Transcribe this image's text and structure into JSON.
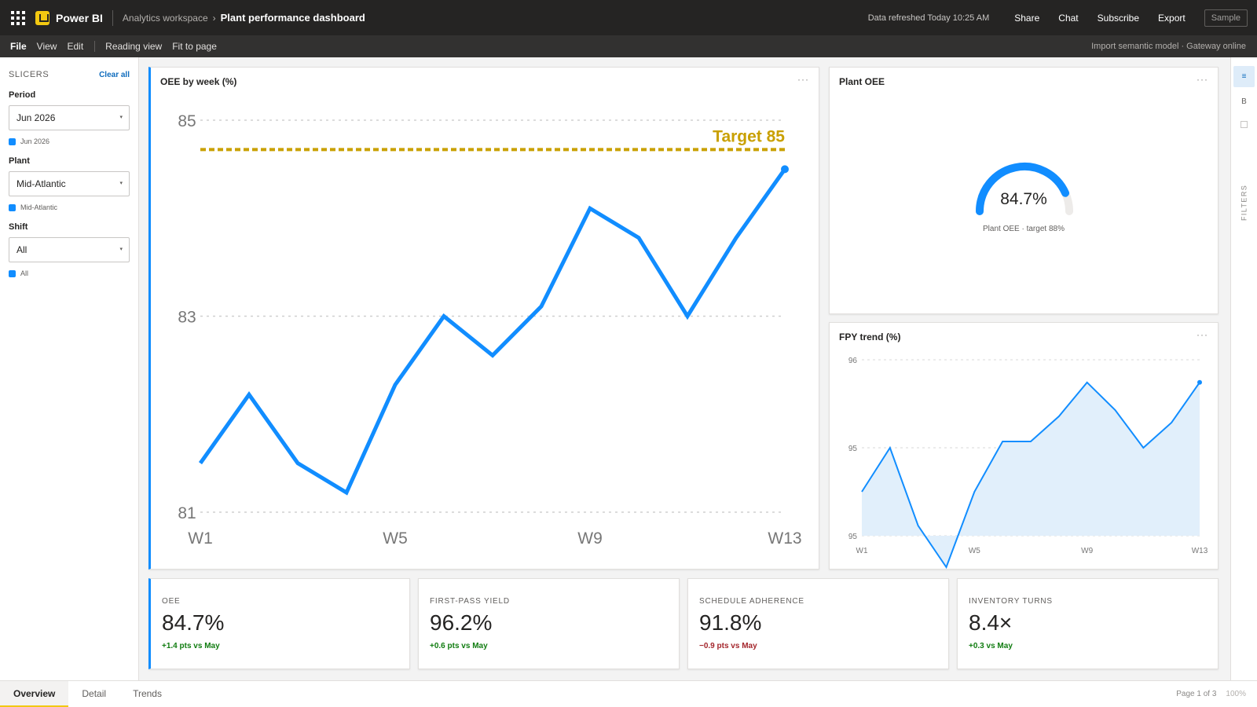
{
  "app": {
    "name": "Power BI",
    "workspace": "Analytics workspace",
    "crumb_sep": "›",
    "report_title": "Plant performance dashboard",
    "refresh_status": "Data refreshed Today 10:25 AM",
    "actions": [
      "Share",
      "Chat",
      "Subscribe",
      "Export"
    ],
    "mode_badge": "Sample"
  },
  "menu": {
    "items": [
      "File",
      "View",
      "Edit"
    ],
    "view_items": [
      "Reading view",
      "Fit to page"
    ],
    "model_status": "Import semantic model · Gateway online"
  },
  "slicers": {
    "title": "SLICERS",
    "clear_all": "Clear all",
    "groups": [
      {
        "label": "Period",
        "value": "Jun 2026",
        "chip": "Jun 2026"
      },
      {
        "label": "Plant",
        "value": "Mid-Atlantic",
        "chip": "Mid-Atlantic"
      },
      {
        "label": "Shift",
        "value": "All",
        "chip": "All"
      }
    ],
    "chevron": "▾"
  },
  "more_glyph": "···",
  "oee_chart": {
    "title": "OEE by week (%)",
    "target_label": "Target 85"
  },
  "gauge": {
    "title": "Plant OEE",
    "value_label": "84.7%",
    "caption": "Plant OEE · target 88%",
    "value": 84.7,
    "target": 88
  },
  "fpy_chart": {
    "title": "FPY trend (%)"
  },
  "chart_data": [
    {
      "type": "line",
      "title": "OEE by week (%)",
      "categories": [
        "W1",
        "W2",
        "W3",
        "W4",
        "W5",
        "W6",
        "W7",
        "W8",
        "W9",
        "W10",
        "W11",
        "W12",
        "W13"
      ],
      "x_tick_labels": [
        "W1",
        "W5",
        "W9",
        "W13"
      ],
      "y_tick_labels": [
        "85",
        "83",
        "81"
      ],
      "ylim": [
        81,
        85
      ],
      "series": [
        {
          "values": [
            81.5,
            82.2,
            81.5,
            81.2,
            82.3,
            83.0,
            82.6,
            83.1,
            84.1,
            83.8,
            83.0,
            83.8,
            84.5
          ]
        }
      ],
      "target": {
        "label": "Target 85",
        "value": 84.7
      },
      "grid": true,
      "colors": {
        "line": "#118dff",
        "target": "#c9a000",
        "grid": "#d0d0d0"
      }
    },
    {
      "type": "area",
      "title": "FPY trend (%)",
      "categories": [
        "W1",
        "W2",
        "W3",
        "W4",
        "W5",
        "W6",
        "W7",
        "W8",
        "W9",
        "W10",
        "W11",
        "W12",
        "W13"
      ],
      "x_tick_labels": [
        "W1",
        "W5",
        "W9",
        "W13"
      ],
      "y_tick_labels": [
        "96",
        "95",
        "95"
      ],
      "ylim": [
        94.8,
        96.2
      ],
      "series": [
        {
          "values": [
            95.15,
            95.5,
            94.88,
            94.55,
            95.15,
            95.55,
            95.55,
            95.75,
            96.02,
            95.8,
            95.5,
            95.7,
            96.02
          ]
        }
      ],
      "grid": true,
      "colors": {
        "line": "#118dff",
        "fill": "#e1effb",
        "grid": "#d8d8d8"
      }
    }
  ],
  "kpis": [
    {
      "label": "OEE",
      "value": "84.7%",
      "delta": "+1.4 pts vs May",
      "trend": "pos"
    },
    {
      "label": "FIRST-PASS YIELD",
      "value": "96.2%",
      "delta": "+0.6 pts vs May",
      "trend": "pos"
    },
    {
      "label": "SCHEDULE ADHERENCE",
      "value": "91.8%",
      "delta": "−0.9 pts vs May",
      "trend": "neg"
    },
    {
      "label": "INVENTORY TURNS",
      "value": "8.4×",
      "delta": "+0.3 vs May",
      "trend": "pos"
    }
  ],
  "rail": {
    "buttons": [
      "≡",
      "B"
    ],
    "filters_label": "FILTERS"
  },
  "footer": {
    "tabs": [
      "Overview",
      "Detail",
      "Trends"
    ],
    "page_info": "Page 1 of 3",
    "zoom": "100%"
  },
  "colors": {
    "accent": "#118dff",
    "brand": "#f2c811",
    "positive": "#107c10",
    "negative": "#a4262c"
  }
}
